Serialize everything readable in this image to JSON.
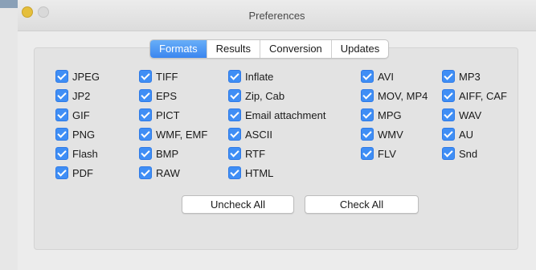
{
  "window": {
    "title": "Preferences"
  },
  "tabs": [
    {
      "label": "Formats",
      "active": true
    },
    {
      "label": "Results",
      "active": false
    },
    {
      "label": "Conversion",
      "active": false
    },
    {
      "label": "Updates",
      "active": false
    }
  ],
  "formats": {
    "col1": [
      "JPEG",
      "JP2",
      "GIF",
      "PNG",
      "Flash",
      "PDF"
    ],
    "col2": [
      "TIFF",
      "EPS",
      "PICT",
      "WMF, EMF",
      "BMP",
      "RAW"
    ],
    "col3": [
      "Inflate",
      "Zip, Cab",
      "Email attachment",
      "ASCII",
      "RTF",
      "HTML"
    ],
    "col4": [
      "AVI",
      "MOV, MP4",
      "MPG",
      "WMV",
      "FLV"
    ],
    "col5": [
      "MP3",
      "AIFF, CAF",
      "WAV",
      "AU",
      "Snd"
    ]
  },
  "buttons": {
    "uncheck_all": "Uncheck All",
    "check_all": "Check All"
  },
  "colors": {
    "accent": "#3f8ef5",
    "tab_active": "#4a94f2",
    "close": "#fc5b57",
    "minimize": "#e5bf3c"
  }
}
